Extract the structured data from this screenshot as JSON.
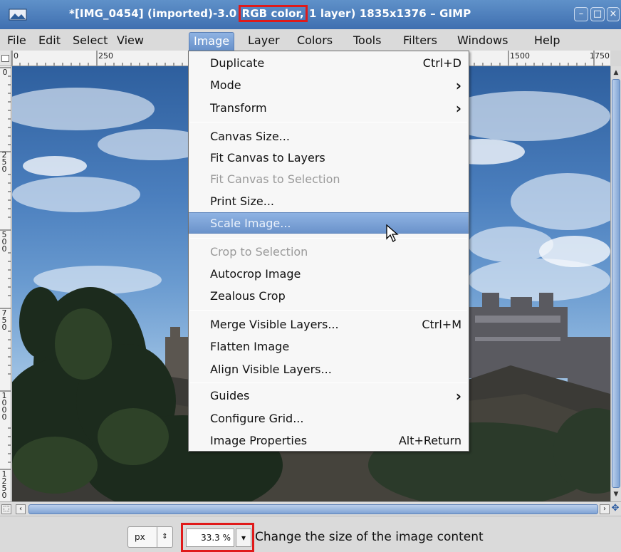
{
  "window": {
    "title_prefix": "*[IMG_0454] (imported)-3.0",
    "title_highlight": "RGB color,",
    "title_suffix": "1 layer) 1835x1376 – GIMP",
    "buttons": {
      "minimize": "–",
      "maximize": "□",
      "close": "×"
    }
  },
  "menubar": {
    "items": [
      {
        "label": "File"
      },
      {
        "label": "Edit"
      },
      {
        "label": "Select"
      },
      {
        "label": "View"
      },
      {
        "label": "Image"
      },
      {
        "label": "Layer"
      },
      {
        "label": "Colors"
      },
      {
        "label": "Tools"
      },
      {
        "label": "Filters"
      },
      {
        "label": "Windows"
      },
      {
        "label": "Help"
      }
    ]
  },
  "ruler": {
    "h_labels": [
      "0",
      "250",
      "1500",
      "1750"
    ],
    "v_labels": [
      "0",
      "250",
      "500",
      "750",
      "1000",
      "1250"
    ]
  },
  "image_menu": {
    "items": [
      {
        "label": "Duplicate",
        "accel": "Ctrl+D"
      },
      {
        "label": "Mode",
        "submenu": "›"
      },
      {
        "label": "Transform",
        "submenu": "›"
      },
      {
        "label": "Canvas Size..."
      },
      {
        "label": "Fit Canvas to Layers"
      },
      {
        "label": "Fit Canvas to Selection"
      },
      {
        "label": "Print Size..."
      },
      {
        "label": "Scale Image..."
      },
      {
        "label": "Crop to Selection"
      },
      {
        "label": "Autocrop Image"
      },
      {
        "label": "Zealous Crop"
      },
      {
        "label": "Merge Visible Layers...",
        "accel": "Ctrl+M"
      },
      {
        "label": "Flatten Image"
      },
      {
        "label": "Align Visible Layers..."
      },
      {
        "label": "Guides",
        "submenu": "›"
      },
      {
        "label": "Configure Grid..."
      },
      {
        "label": "Image Properties",
        "accel": "Alt+Return"
      }
    ]
  },
  "statusbar": {
    "unit": "px",
    "zoom": "33.3 %",
    "message": "Change the size of the image content"
  },
  "colors": {
    "highlight_box": "#e01a1a",
    "menu_highlight": "#7aa0d6",
    "title_bar": "#4a7dbb"
  }
}
